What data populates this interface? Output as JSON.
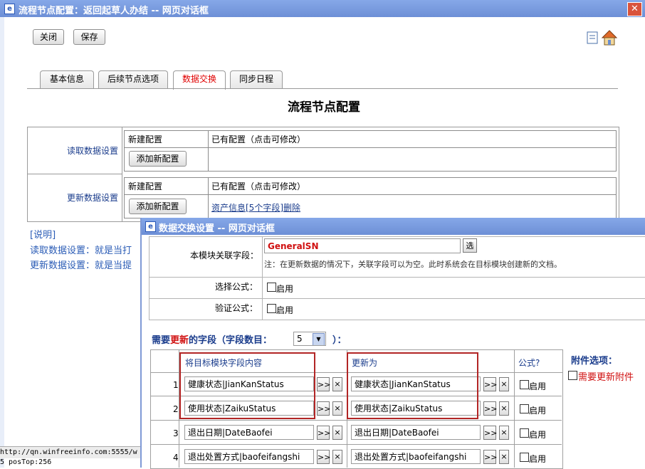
{
  "window": {
    "title": "流程节点配置：返回起草人办结 -- 网页对话框",
    "close": "✕"
  },
  "toolbar": {
    "close_label": "关闭",
    "save_label": "保存"
  },
  "tabs": [
    {
      "label": "基本信息"
    },
    {
      "label": "后续节点选项"
    },
    {
      "label": "数据交换"
    },
    {
      "label": "同步日程"
    }
  ],
  "page_title": "流程节点配置",
  "read_section": {
    "label": "读取数据设置",
    "new_config": "新建配置",
    "existing_config": "已有配置（点击可修改）",
    "add_button": "添加新配置"
  },
  "update_section": {
    "label": "更新数据设置",
    "new_config": "新建配置",
    "existing_config": "已有配置（点击可修改）",
    "add_button": "添加新配置",
    "existing_link": "资产信息[5个字段]",
    "delete_link": "删除"
  },
  "notes": {
    "title": "[说明]",
    "line1": "读取数据设置：就是当打",
    "line2": "更新数据设置：就是当提"
  },
  "status": {
    "url": "http://qn.winfreeinfo.com:5555/w",
    "line2": "5  posTop:256"
  },
  "dialog": {
    "title": "数据交换设置 -- 网页对话框",
    "link_field_label": "本模块关联字段：",
    "link_field_value": "GeneralSN",
    "select_button": "选",
    "link_note": "注：在更新数据的情况下，关联字段可以为空。此时系统会在目标模块创建新的文档。",
    "formula_select_label": "选择公式：",
    "formula_verify_label": "验证公式：",
    "enable": "启用",
    "fields_heading_pre": "需要",
    "fields_heading_red": "更新",
    "fields_heading_post": "的字段（字段数目：",
    "field_count": "5",
    "fields_heading_end": "）：",
    "col_source": "将目标模块字段内容",
    "col_target": "更新为",
    "col_formula": "公式?",
    "move_button": ">>",
    "remove_button": "×",
    "attach_title": "附件选项：",
    "attach_option": "需要更新附件",
    "rows": [
      {
        "num": "1",
        "source": "健康状态|JianKanStatus",
        "target": "健康状态|JianKanStatus",
        "enable": "启用"
      },
      {
        "num": "2",
        "source": "使用状态|ZaikuStatus",
        "target": "使用状态|ZaikuStatus",
        "enable": "启用"
      },
      {
        "num": "3",
        "source": "退出日期|DateBaofei",
        "target": "退出日期|DateBaofei",
        "enable": "启用"
      },
      {
        "num": "4",
        "source": "退出处置方式|baofeifangshi",
        "target": "退出处置方式|baofeifangshi",
        "enable": "启用"
      }
    ]
  },
  "colors": {
    "title_bar": "#6d8fd6",
    "active_tab": "#e00000",
    "link": "#1a3c8c",
    "highlight_box": "#b22525"
  }
}
